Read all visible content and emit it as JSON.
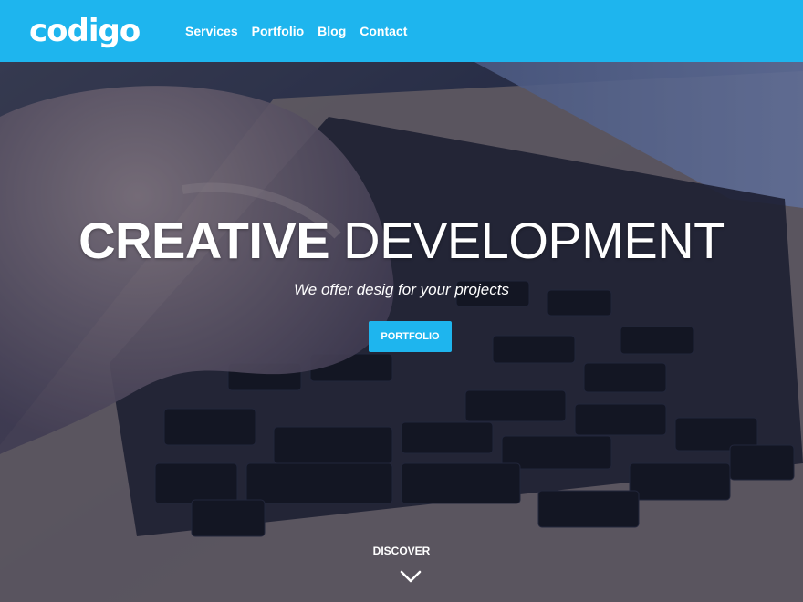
{
  "brand": {
    "logo_text": "codigo"
  },
  "nav": {
    "items": [
      "Services",
      "Portfolio",
      "Blog",
      "Contact"
    ]
  },
  "hero": {
    "title_strong": "CREATIVE",
    "title_light": "DEVELOPMENT",
    "subtitle": "We offer desig  for your projects",
    "button_label": "PORTFOLIO",
    "discover_label": "DISCOVER"
  },
  "colors": {
    "accent": "#1eb5ee",
    "text": "#ffffff"
  },
  "icons": {
    "scroll": "chevron-down-icon"
  }
}
